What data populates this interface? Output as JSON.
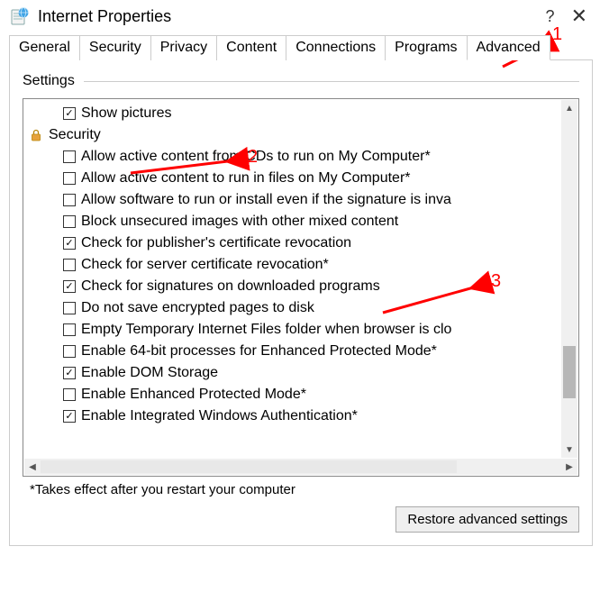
{
  "window": {
    "title": "Internet Properties",
    "help": "?",
    "close": "✕"
  },
  "tabs": {
    "general": "General",
    "security": "Security",
    "privacy": "Privacy",
    "content": "Content",
    "connections": "Connections",
    "programs": "Programs",
    "advanced": "Advanced"
  },
  "group": {
    "title": "Settings"
  },
  "items": [
    {
      "label": "Show pictures",
      "checked": true,
      "indent": true,
      "type": "check"
    },
    {
      "label": "Security",
      "type": "category"
    },
    {
      "label": "Allow active content from CDs to run on My Computer*",
      "checked": false,
      "indent": true,
      "type": "check"
    },
    {
      "label": "Allow active content to run in files on My Computer*",
      "checked": false,
      "indent": true,
      "type": "check"
    },
    {
      "label": "Allow software to run or install even if the signature is inva",
      "checked": false,
      "indent": true,
      "type": "check"
    },
    {
      "label": "Block unsecured images with other mixed content",
      "checked": false,
      "indent": true,
      "type": "check"
    },
    {
      "label": "Check for publisher's certificate revocation",
      "checked": true,
      "indent": true,
      "type": "check"
    },
    {
      "label": "Check for server certificate revocation*",
      "checked": false,
      "indent": true,
      "type": "check"
    },
    {
      "label": "Check for signatures on downloaded programs",
      "checked": true,
      "indent": true,
      "type": "check"
    },
    {
      "label": "Do not save encrypted pages to disk",
      "checked": false,
      "indent": true,
      "type": "check"
    },
    {
      "label": "Empty Temporary Internet Files folder when browser is clo",
      "checked": false,
      "indent": true,
      "type": "check"
    },
    {
      "label": "Enable 64-bit processes for Enhanced Protected Mode*",
      "checked": false,
      "indent": true,
      "type": "check"
    },
    {
      "label": "Enable DOM Storage",
      "checked": true,
      "indent": true,
      "type": "check"
    },
    {
      "label": "Enable Enhanced Protected Mode*",
      "checked": false,
      "indent": true,
      "type": "check"
    },
    {
      "label": "Enable Integrated Windows Authentication*",
      "checked": true,
      "indent": true,
      "type": "check"
    }
  ],
  "footnote": "*Takes effect after you restart your computer",
  "restore": "Restore advanced settings",
  "annotations": {
    "n1": "1",
    "n2": "2",
    "n3": "3"
  }
}
